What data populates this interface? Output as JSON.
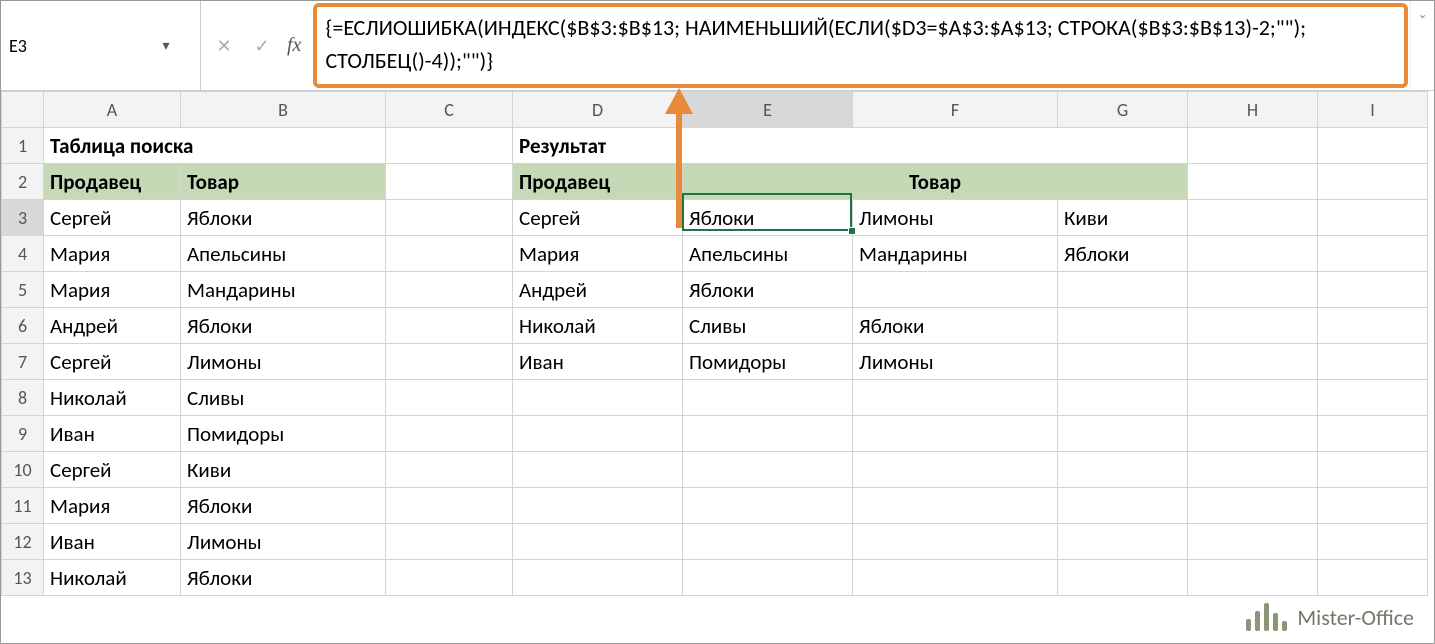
{
  "nameBox": "E3",
  "formula": "{=ЕСЛИОШИБКА(ИНДЕКС($B$3:$B$13; НАИМЕНЬШИЙ(ЕСЛИ($D3=$A$3:$A$13; СТРОКА($B$3:$B$13)-2;\"\"); СТОЛБЕЦ()-4));\"\")}",
  "columns": [
    "A",
    "B",
    "C",
    "D",
    "E",
    "F",
    "G",
    "H",
    "I"
  ],
  "rows": [
    "1",
    "2",
    "3",
    "4",
    "5",
    "6",
    "7",
    "8",
    "9",
    "10",
    "11",
    "12",
    "13"
  ],
  "titles": {
    "searchTable": "Таблица поиска",
    "result": "Результат"
  },
  "headers": {
    "seller": "Продавец",
    "product": "Товар"
  },
  "lookup": [
    {
      "seller": "Сергей",
      "product": "Яблоки"
    },
    {
      "seller": "Мария",
      "product": "Апельсины"
    },
    {
      "seller": "Мария",
      "product": "Мандарины"
    },
    {
      "seller": "Андрей",
      "product": "Яблоки"
    },
    {
      "seller": "Сергей",
      "product": "Лимоны"
    },
    {
      "seller": "Николай",
      "product": "Сливы"
    },
    {
      "seller": "Иван",
      "product": "Помидоры"
    },
    {
      "seller": "Сергей",
      "product": "Киви"
    },
    {
      "seller": "Мария",
      "product": "Яблоки"
    },
    {
      "seller": "Иван",
      "product": "Лимоны"
    },
    {
      "seller": "Николай",
      "product": "Яблоки"
    }
  ],
  "result": [
    {
      "seller": "Сергей",
      "p1": "Яблоки",
      "p2": "Лимоны",
      "p3": "Киви"
    },
    {
      "seller": "Мария",
      "p1": "Апельсины",
      "p2": "Мандарины",
      "p3": "Яблоки"
    },
    {
      "seller": "Андрей",
      "p1": "Яблоки",
      "p2": "",
      "p3": ""
    },
    {
      "seller": "Николай",
      "p1": "Сливы",
      "p2": "Яблоки",
      "p3": ""
    },
    {
      "seller": "Иван",
      "p1": "Помидоры",
      "p2": "Лимоны",
      "p3": ""
    }
  ],
  "buttons": {
    "cancel": "✕",
    "enter": "✓",
    "dropdown": "▾",
    "expand": "⌄"
  },
  "fxLabel": "fx",
  "logo": "Mister-Office"
}
